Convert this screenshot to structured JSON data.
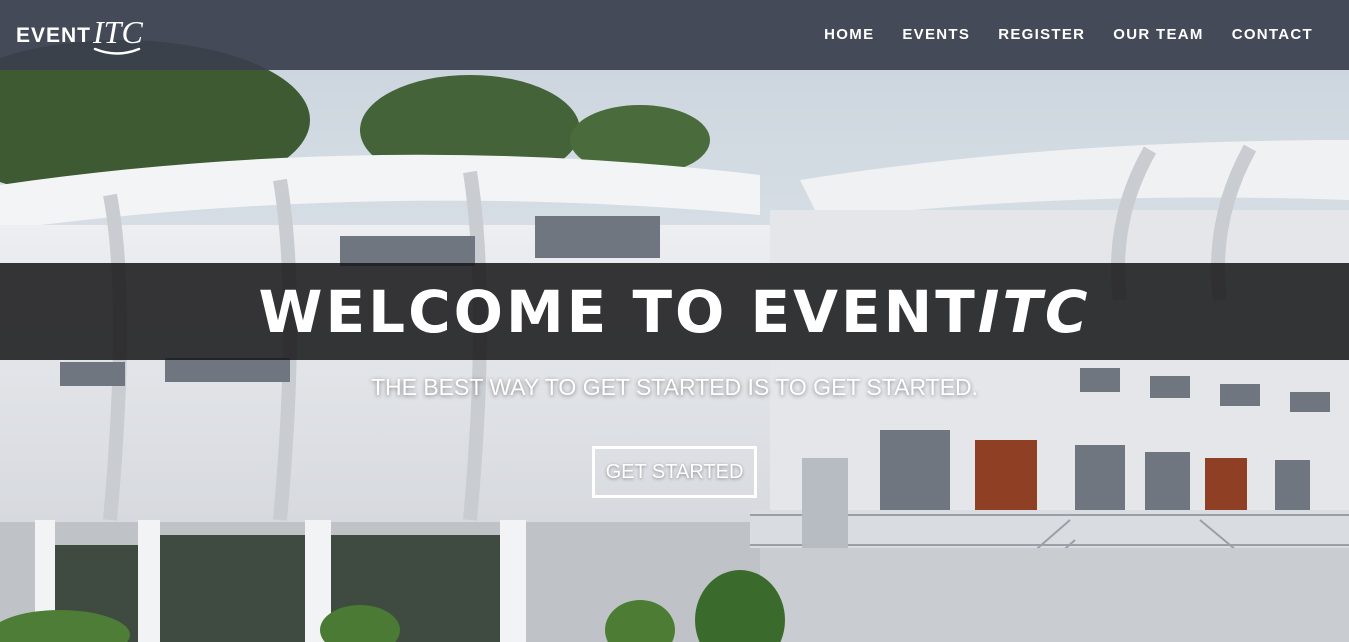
{
  "brand": {
    "main": "EVENT",
    "accent": "ITC"
  },
  "nav": {
    "items": [
      {
        "label": "HOME"
      },
      {
        "label": "EVENTS"
      },
      {
        "label": "REGISTER"
      },
      {
        "label": "OUR TEAM"
      },
      {
        "label": "CONTACT"
      }
    ]
  },
  "hero": {
    "title_main": "WELCOME TO EVENT",
    "title_accent": "ITC",
    "tagline": "THE BEST WAY TO GET STARTED IS TO GET STARTED.",
    "cta_label": "GET STARTED"
  },
  "colors": {
    "navbar": "#3a404d",
    "band": "#161618",
    "text": "#ffffff"
  }
}
